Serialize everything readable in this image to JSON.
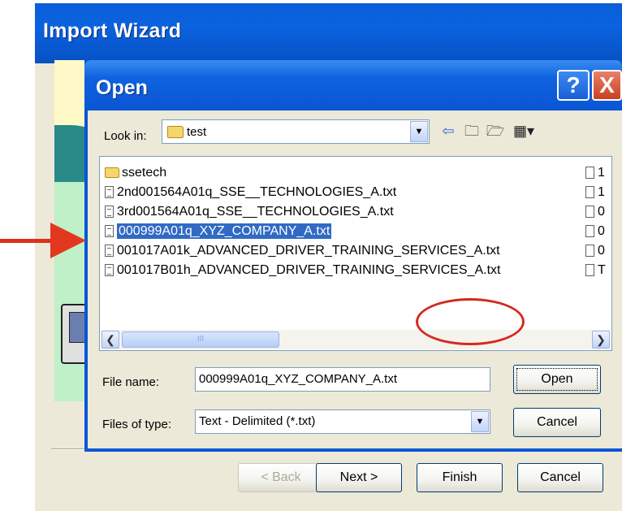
{
  "wizard": {
    "title": "Import Wizard",
    "buttons": {
      "back": "< Back",
      "next": "Next >",
      "finish": "Finish",
      "cancel": "Cancel"
    }
  },
  "open_dialog": {
    "title": "Open",
    "help_label": "?",
    "close_label": "X",
    "look_in_label": "Look in:",
    "look_in_value": "test",
    "toolbar_icons": [
      "back-arrow-icon",
      "up-folder-icon",
      "new-folder-icon",
      "view-menu-icon"
    ],
    "files": [
      {
        "name": "ssetech",
        "type": "folder"
      },
      {
        "name": "2nd001564A01q_SSE__TECHNOLOGIES_A.txt",
        "type": "file"
      },
      {
        "name": "3rd001564A01q_SSE__TECHNOLOGIES_A.txt",
        "type": "file"
      },
      {
        "name": "000999A01q_XYZ_COMPANY_A.txt",
        "type": "file",
        "selected": true
      },
      {
        "name": "001017A01k_ADVANCED_DRIVER_TRAINING_SERVICES_A.txt",
        "type": "file"
      },
      {
        "name": "001017B01h_ADVANCED_DRIVER_TRAINING_SERVICES_A.txt",
        "type": "file"
      }
    ],
    "files_col2": [
      "1",
      "1",
      "0",
      "0",
      "0",
      "T"
    ],
    "scroll_thumb_grip": "III",
    "file_name_label": "File name:",
    "file_name_value": "000999A01q_XYZ_COMPANY_A.txt",
    "files_of_type_label": "Files of type:",
    "files_of_type_value": "Text - Delimited (*.txt)",
    "open_button": "Open",
    "cancel_button": "Cancel"
  },
  "colors": {
    "title_blue": "#0a56d4",
    "selection": "#316ac5",
    "annotation_red": "#d9321c",
    "dialog_bg": "#ece9d8"
  }
}
